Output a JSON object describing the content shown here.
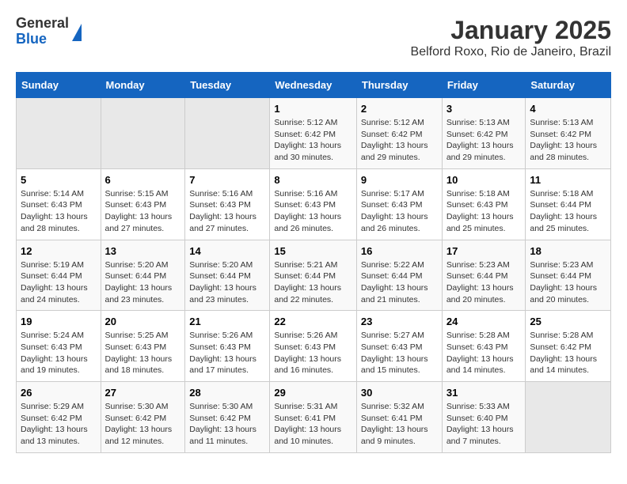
{
  "logo": {
    "general": "General",
    "blue": "Blue"
  },
  "title": "January 2025",
  "subtitle": "Belford Roxo, Rio de Janeiro, Brazil",
  "headers": [
    "Sunday",
    "Monday",
    "Tuesday",
    "Wednesday",
    "Thursday",
    "Friday",
    "Saturday"
  ],
  "weeks": [
    [
      {
        "day": "",
        "info": ""
      },
      {
        "day": "",
        "info": ""
      },
      {
        "day": "",
        "info": ""
      },
      {
        "day": "1",
        "info": "Sunrise: 5:12 AM\nSunset: 6:42 PM\nDaylight: 13 hours\nand 30 minutes."
      },
      {
        "day": "2",
        "info": "Sunrise: 5:12 AM\nSunset: 6:42 PM\nDaylight: 13 hours\nand 29 minutes."
      },
      {
        "day": "3",
        "info": "Sunrise: 5:13 AM\nSunset: 6:42 PM\nDaylight: 13 hours\nand 29 minutes."
      },
      {
        "day": "4",
        "info": "Sunrise: 5:13 AM\nSunset: 6:42 PM\nDaylight: 13 hours\nand 28 minutes."
      }
    ],
    [
      {
        "day": "5",
        "info": "Sunrise: 5:14 AM\nSunset: 6:43 PM\nDaylight: 13 hours\nand 28 minutes."
      },
      {
        "day": "6",
        "info": "Sunrise: 5:15 AM\nSunset: 6:43 PM\nDaylight: 13 hours\nand 27 minutes."
      },
      {
        "day": "7",
        "info": "Sunrise: 5:16 AM\nSunset: 6:43 PM\nDaylight: 13 hours\nand 27 minutes."
      },
      {
        "day": "8",
        "info": "Sunrise: 5:16 AM\nSunset: 6:43 PM\nDaylight: 13 hours\nand 26 minutes."
      },
      {
        "day": "9",
        "info": "Sunrise: 5:17 AM\nSunset: 6:43 PM\nDaylight: 13 hours\nand 26 minutes."
      },
      {
        "day": "10",
        "info": "Sunrise: 5:18 AM\nSunset: 6:43 PM\nDaylight: 13 hours\nand 25 minutes."
      },
      {
        "day": "11",
        "info": "Sunrise: 5:18 AM\nSunset: 6:44 PM\nDaylight: 13 hours\nand 25 minutes."
      }
    ],
    [
      {
        "day": "12",
        "info": "Sunrise: 5:19 AM\nSunset: 6:44 PM\nDaylight: 13 hours\nand 24 minutes."
      },
      {
        "day": "13",
        "info": "Sunrise: 5:20 AM\nSunset: 6:44 PM\nDaylight: 13 hours\nand 23 minutes."
      },
      {
        "day": "14",
        "info": "Sunrise: 5:20 AM\nSunset: 6:44 PM\nDaylight: 13 hours\nand 23 minutes."
      },
      {
        "day": "15",
        "info": "Sunrise: 5:21 AM\nSunset: 6:44 PM\nDaylight: 13 hours\nand 22 minutes."
      },
      {
        "day": "16",
        "info": "Sunrise: 5:22 AM\nSunset: 6:44 PM\nDaylight: 13 hours\nand 21 minutes."
      },
      {
        "day": "17",
        "info": "Sunrise: 5:23 AM\nSunset: 6:44 PM\nDaylight: 13 hours\nand 20 minutes."
      },
      {
        "day": "18",
        "info": "Sunrise: 5:23 AM\nSunset: 6:44 PM\nDaylight: 13 hours\nand 20 minutes."
      }
    ],
    [
      {
        "day": "19",
        "info": "Sunrise: 5:24 AM\nSunset: 6:43 PM\nDaylight: 13 hours\nand 19 minutes."
      },
      {
        "day": "20",
        "info": "Sunrise: 5:25 AM\nSunset: 6:43 PM\nDaylight: 13 hours\nand 18 minutes."
      },
      {
        "day": "21",
        "info": "Sunrise: 5:26 AM\nSunset: 6:43 PM\nDaylight: 13 hours\nand 17 minutes."
      },
      {
        "day": "22",
        "info": "Sunrise: 5:26 AM\nSunset: 6:43 PM\nDaylight: 13 hours\nand 16 minutes."
      },
      {
        "day": "23",
        "info": "Sunrise: 5:27 AM\nSunset: 6:43 PM\nDaylight: 13 hours\nand 15 minutes."
      },
      {
        "day": "24",
        "info": "Sunrise: 5:28 AM\nSunset: 6:43 PM\nDaylight: 13 hours\nand 14 minutes."
      },
      {
        "day": "25",
        "info": "Sunrise: 5:28 AM\nSunset: 6:42 PM\nDaylight: 13 hours\nand 14 minutes."
      }
    ],
    [
      {
        "day": "26",
        "info": "Sunrise: 5:29 AM\nSunset: 6:42 PM\nDaylight: 13 hours\nand 13 minutes."
      },
      {
        "day": "27",
        "info": "Sunrise: 5:30 AM\nSunset: 6:42 PM\nDaylight: 13 hours\nand 12 minutes."
      },
      {
        "day": "28",
        "info": "Sunrise: 5:30 AM\nSunset: 6:42 PM\nDaylight: 13 hours\nand 11 minutes."
      },
      {
        "day": "29",
        "info": "Sunrise: 5:31 AM\nSunset: 6:41 PM\nDaylight: 13 hours\nand 10 minutes."
      },
      {
        "day": "30",
        "info": "Sunrise: 5:32 AM\nSunset: 6:41 PM\nDaylight: 13 hours\nand 9 minutes."
      },
      {
        "day": "31",
        "info": "Sunrise: 5:33 AM\nSunset: 6:40 PM\nDaylight: 13 hours\nand 7 minutes."
      },
      {
        "day": "",
        "info": ""
      }
    ]
  ]
}
